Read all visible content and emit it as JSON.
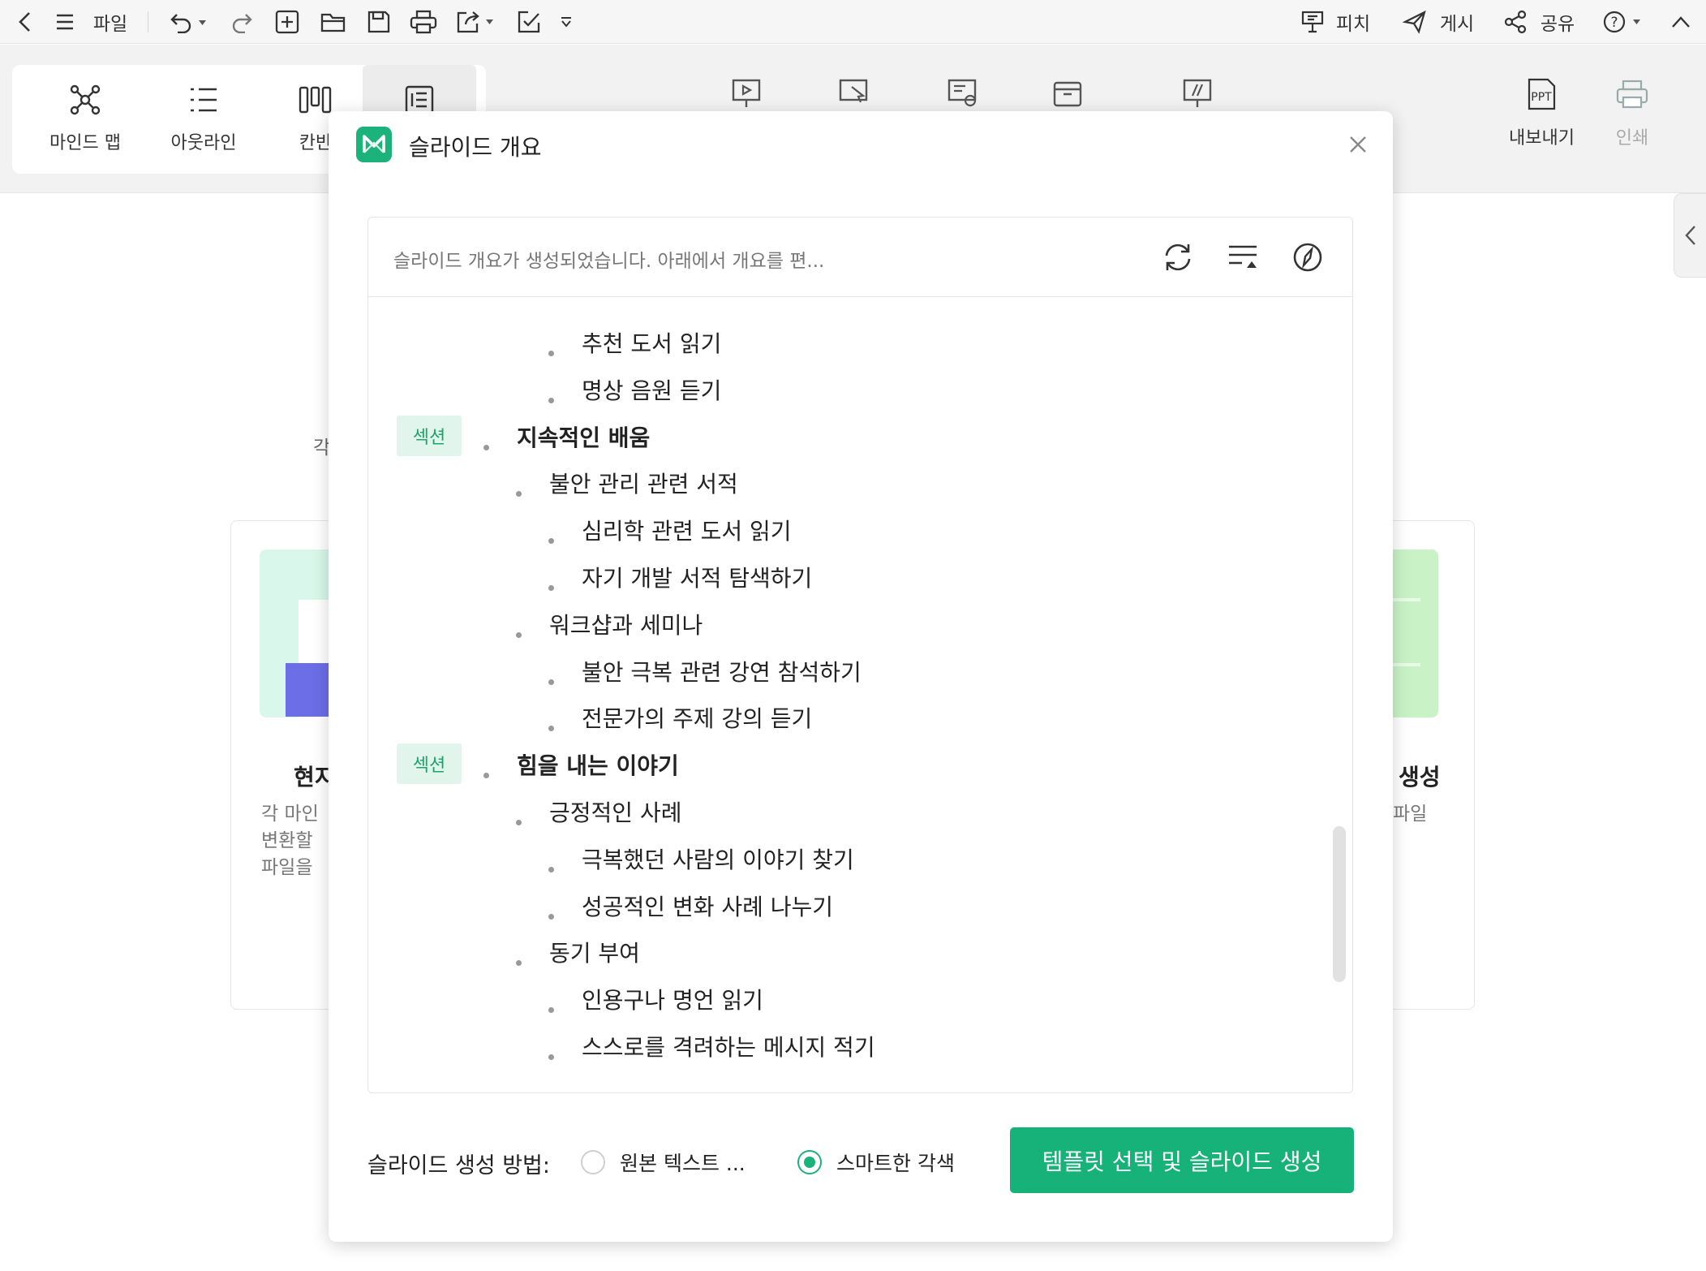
{
  "toolbar": {
    "file_label": "파일",
    "pitch_label": "피치",
    "publish_label": "게시",
    "share_label": "공유"
  },
  "views": {
    "mindmap_label": "마인드 맵",
    "outline_label": "아웃라인",
    "kanban_label": "칸반"
  },
  "right_actions": {
    "export_label": "내보내기",
    "print_label": "인쇄"
  },
  "background": {
    "partial_char": "각",
    "card_left_title": "현지",
    "card_left_desc": [
      "각 마인",
      "변환할",
      "파일을"
    ],
    "card_right_title": "생성",
    "card_right_desc": "파일"
  },
  "modal": {
    "title": "슬라이드 개요",
    "status_text": "슬라이드 개요가 생성되었습니다. 아래에서 개요를 편...",
    "badge_label": "섹션",
    "outline": [
      {
        "level": 3,
        "text": "추천 도서 읽기"
      },
      {
        "level": 3,
        "text": "명상 음원 듣기"
      },
      {
        "level": 1,
        "text": "지속적인 배움",
        "badge": true
      },
      {
        "level": 2,
        "text": "불안 관리 관련 서적"
      },
      {
        "level": 3,
        "text": "심리학 관련 도서 읽기"
      },
      {
        "level": 3,
        "text": "자기 개발 서적 탐색하기"
      },
      {
        "level": 2,
        "text": "워크샵과 세미나"
      },
      {
        "level": 3,
        "text": "불안 극복 관련 강연 참석하기"
      },
      {
        "level": 3,
        "text": "전문가의 주제 강의 듣기"
      },
      {
        "level": 1,
        "text": "힘을 내는 이야기",
        "badge": true
      },
      {
        "level": 2,
        "text": "긍정적인 사례"
      },
      {
        "level": 3,
        "text": "극복했던 사람의 이야기 찾기"
      },
      {
        "level": 3,
        "text": "성공적인 변화 사례 나누기"
      },
      {
        "level": 2,
        "text": "동기 부여"
      },
      {
        "level": 3,
        "text": "인용구나 명언 읽기"
      },
      {
        "level": 3,
        "text": "스스로를 격려하는 메시지 적기"
      }
    ],
    "method_label": "슬라이드 생성 방법:",
    "option_original": "원본 텍스트 ...",
    "option_smart": "스마트한 각색",
    "selected_option": "smart",
    "primary_button": "템플릿 선택 및 슬라이드 생성"
  },
  "colors": {
    "accent": "#1bb27c",
    "badge_bg": "#e2f5ec",
    "badge_text": "#1aa56c"
  },
  "icons": [
    "back-icon",
    "menu-icon",
    "undo-icon",
    "redo-icon",
    "new-file-icon",
    "open-folder-icon",
    "save-icon",
    "print-icon",
    "export-icon",
    "checklist-icon",
    "more-icon",
    "pitch-icon",
    "publish-icon",
    "share-icon",
    "help-icon",
    "collapse-icon",
    "mindmap-icon",
    "outline-icon",
    "kanban-icon",
    "slides-icon",
    "close-icon",
    "regenerate-icon",
    "expand-collapse-icon",
    "compass-icon",
    "ppt-icon"
  ]
}
